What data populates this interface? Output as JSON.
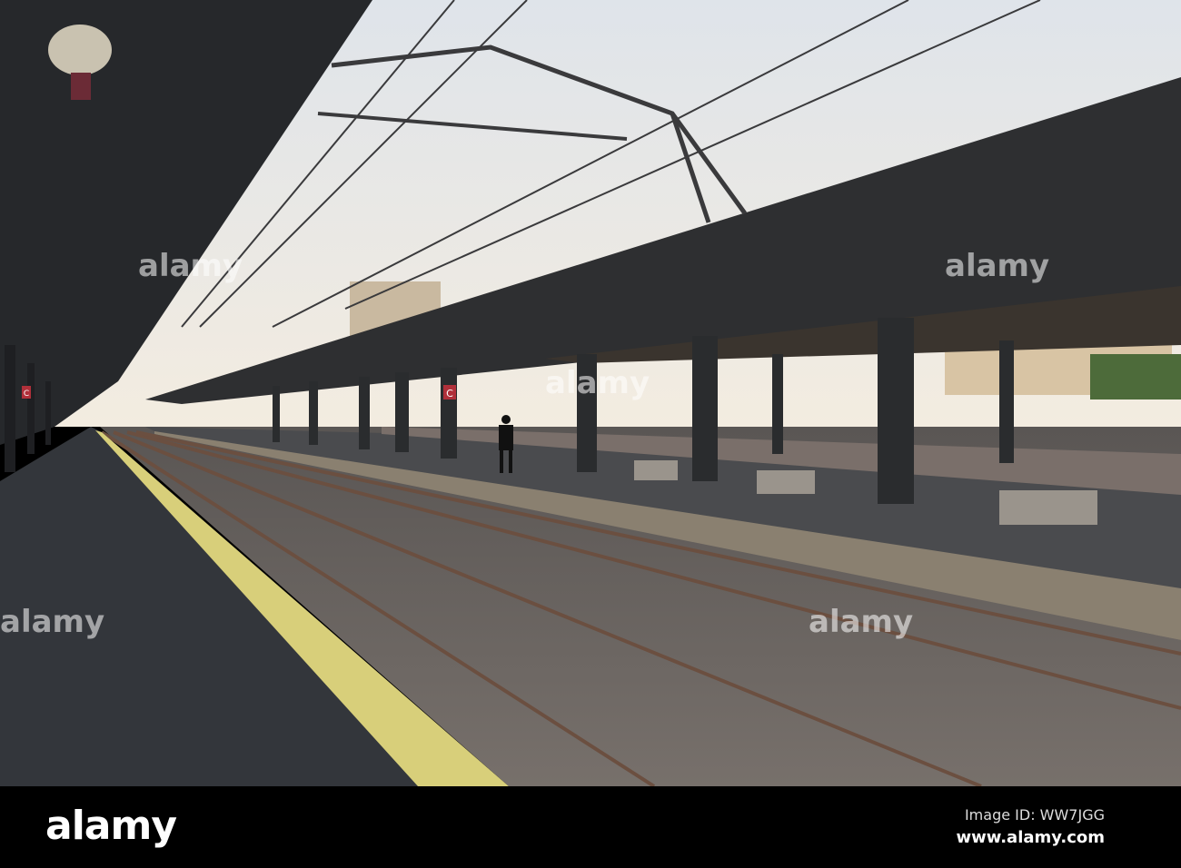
{
  "watermark": {
    "logo": "alamy",
    "overlay_text": "alamy"
  },
  "footer": {
    "logo": "alamy",
    "image_id": "Image ID: WW7JGG",
    "website": "www.alamy.com"
  },
  "scene": {
    "sign_letter": "C",
    "colors": {
      "sky_top": "#dfe4ea",
      "sky_bottom": "#f3ece0",
      "platform": "#3a3d42",
      "yellow_line": "#d8cf7a",
      "canopy": "#26282b"
    }
  }
}
